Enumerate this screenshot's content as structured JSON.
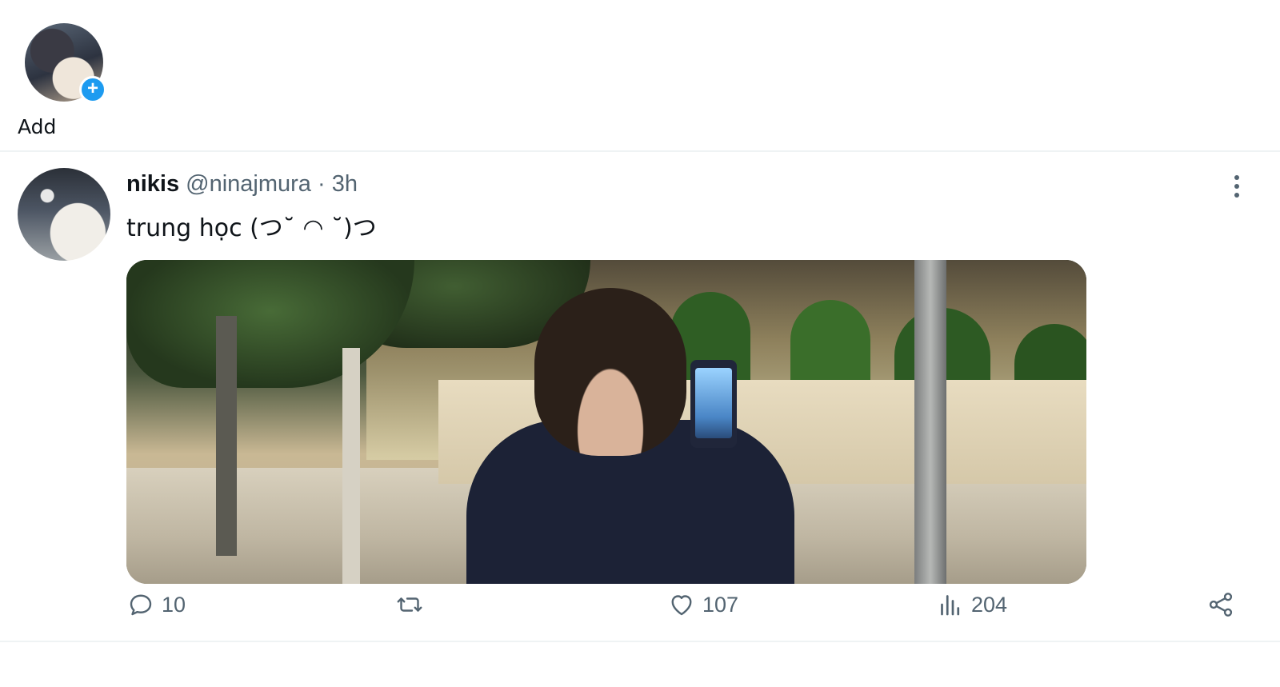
{
  "fleets": {
    "add_label": "Add"
  },
  "tweet": {
    "display_name": "nikis",
    "handle": "@ninajmura",
    "separator": "·",
    "time": "3h",
    "text": "trung học (つ˘ ◠ ˘)つ",
    "actions": {
      "reply_count": "10",
      "retweet_count": "",
      "like_count": "107",
      "views_count": "204"
    }
  },
  "icons": {
    "fleet_plus": "plus-icon",
    "more": "more-vertical-icon",
    "reply": "reply-icon",
    "retweet": "retweet-icon",
    "like": "heart-icon",
    "views": "views-icon",
    "share": "share-icon"
  },
  "colors": {
    "accent": "#1d9bf0",
    "muted_text": "#536471",
    "divider": "#eff3f4"
  }
}
